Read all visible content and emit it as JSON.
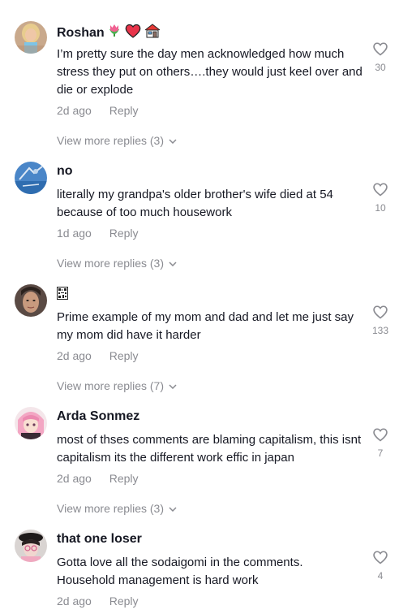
{
  "comments": [
    {
      "username": "Roshan",
      "username_emojis": [
        "tulip-icon",
        "heart-icon",
        "house-icon"
      ],
      "text": "I’m pretty sure the day men acknowledged how much stress they put on others….they would just keel over and die or explode",
      "time": "2d ago",
      "reply_label": "Reply",
      "likes": "30",
      "view_more": "View more replies (3)"
    },
    {
      "username": "no",
      "username_emojis": [],
      "text": "literally my grandpa's older brother's wife died at 54 because of too much housework",
      "time": "1d ago",
      "reply_label": "Reply",
      "likes": "10",
      "view_more": "View more replies (3)"
    },
    {
      "username": "",
      "username_emojis": [
        "qr-glyph-icon"
      ],
      "text": "Prime example of my mom and dad and let me just say my mom did have it harder",
      "time": "2d ago",
      "reply_label": "Reply",
      "likes": "133",
      "view_more": "View more replies (7)"
    },
    {
      "username": "Arda Sonmez",
      "username_emojis": [],
      "text": "most of thses comments are blaming capitalism, this isnt capitalism its the different work effic in japan",
      "time": "2d ago",
      "reply_label": "Reply",
      "likes": "7",
      "view_more": "View more replies (3)"
    },
    {
      "username": "that one loser",
      "username_emojis": [],
      "text": "Gotta love all the sodaigomi in the comments. Household management is hard work",
      "time": "2d ago",
      "reply_label": "Reply",
      "likes": "4",
      "view_more": ""
    }
  ],
  "colors": {
    "text": "#161823",
    "muted": "#8a8b91",
    "background": "#ffffff"
  }
}
